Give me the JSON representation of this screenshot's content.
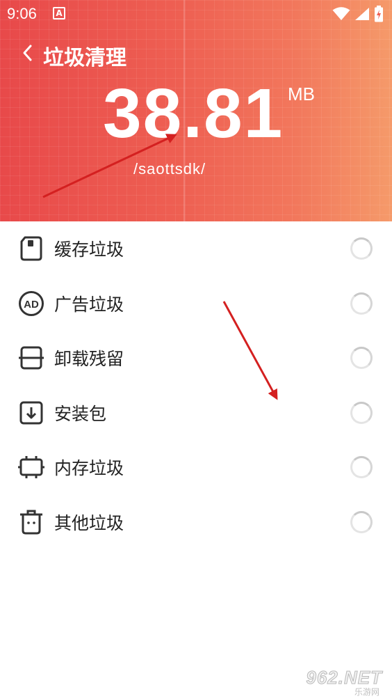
{
  "status_bar": {
    "time": "9:06",
    "notification_icon": "app-notification-icon",
    "notification_letter": "A"
  },
  "header": {
    "back_icon": "chevron-left-icon",
    "title": "垃圾清理",
    "size_value": "38.81",
    "size_unit": "MB",
    "scan_path": "/saottsdk/"
  },
  "categories": [
    {
      "label": "缓存垃圾",
      "icon": "sd-card-icon"
    },
    {
      "label": "广告垃圾",
      "icon": "ad-icon"
    },
    {
      "label": "卸载残留",
      "icon": "uninstall-icon"
    },
    {
      "label": "安装包",
      "icon": "download-box-icon"
    },
    {
      "label": "内存垃圾",
      "icon": "memory-chip-icon"
    },
    {
      "label": "其他垃圾",
      "icon": "trash-icon"
    }
  ],
  "watermark": {
    "main": "962.NET",
    "sub": "乐游网"
  },
  "colors": {
    "header_start": "#e8494a",
    "header_end": "#f59a6a",
    "annotation_arrow": "#d42020"
  }
}
